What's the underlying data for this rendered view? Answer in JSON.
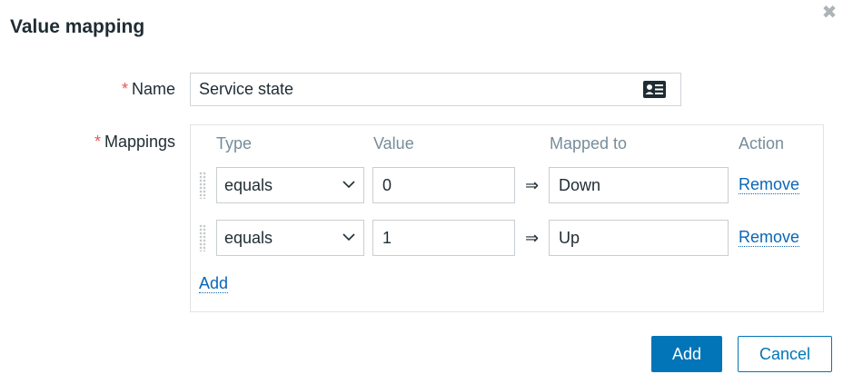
{
  "dialog": {
    "title": "Value mapping",
    "close_glyph": "✖"
  },
  "form": {
    "required_mark": "*",
    "name_label": "Name",
    "name_value": "Service state",
    "mappings_label": "Mappings"
  },
  "mappings": {
    "columns": {
      "type": "Type",
      "value": "Value",
      "mapped_to": "Mapped to",
      "action": "Action"
    },
    "arrow": "⇒",
    "rows": [
      {
        "type": "equals",
        "value": "0",
        "mapped_to": "Down",
        "action": "Remove"
      },
      {
        "type": "equals",
        "value": "1",
        "mapped_to": "Up",
        "action": "Remove"
      }
    ],
    "add_link": "Add"
  },
  "footer": {
    "add_button": "Add",
    "cancel_button": "Cancel"
  },
  "colors": {
    "primary": "#0275b8",
    "link": "#0a66b8",
    "required": "#e45959",
    "header_text": "#768d99"
  }
}
